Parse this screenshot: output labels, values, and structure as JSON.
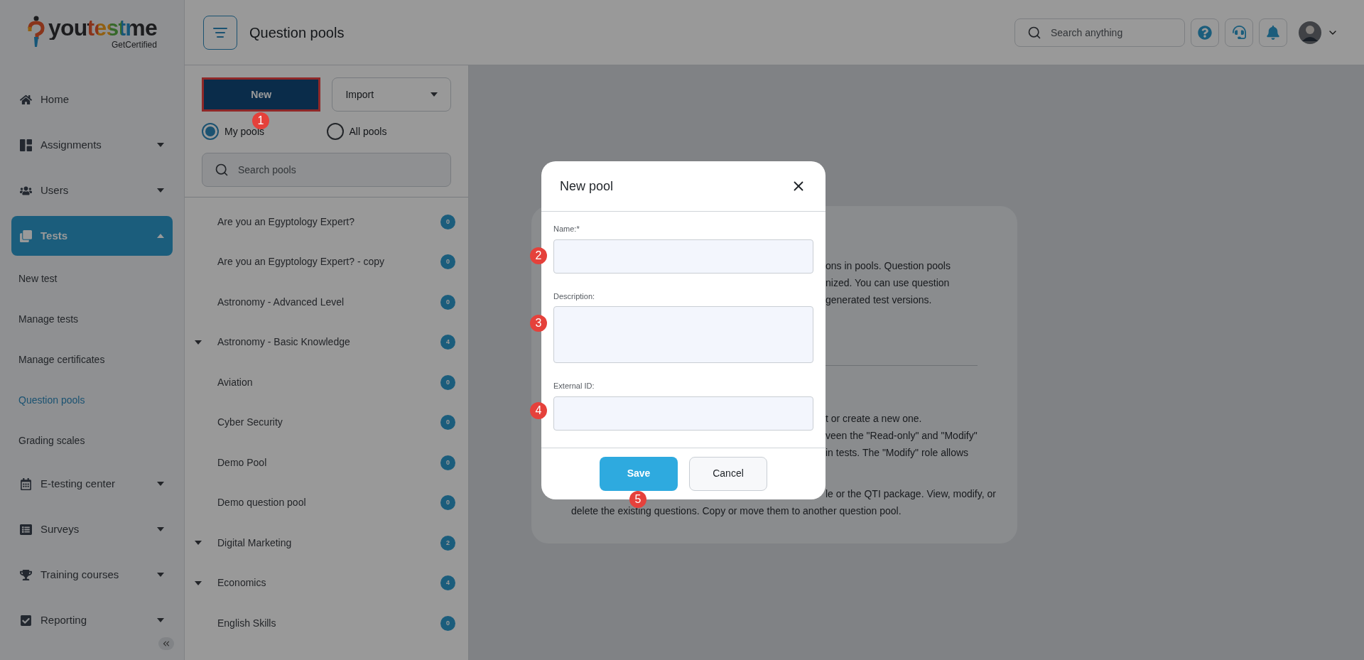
{
  "sidebar": {
    "logo": {
      "wordmark": "youtestme",
      "tagline": "GetCertified"
    },
    "items": [
      {
        "label": "Home",
        "kind": "link",
        "selected": false
      },
      {
        "label": "Assignments",
        "kind": "group",
        "expanded": false,
        "selected": false
      },
      {
        "label": "Users",
        "kind": "group",
        "expanded": false,
        "selected": false
      },
      {
        "label": "Tests",
        "kind": "group",
        "expanded": true,
        "selected": true,
        "children": [
          {
            "label": "New test",
            "selected": false
          },
          {
            "label": "Manage tests",
            "selected": false
          },
          {
            "label": "Manage certificates",
            "selected": false
          },
          {
            "label": "Question pools",
            "selected": true
          },
          {
            "label": "Grading scales",
            "selected": false
          }
        ]
      },
      {
        "label": "E-testing center",
        "kind": "group",
        "expanded": false,
        "selected": false
      },
      {
        "label": "Surveys",
        "kind": "group",
        "expanded": false,
        "selected": false
      },
      {
        "label": "Training courses",
        "kind": "group",
        "expanded": false,
        "selected": false
      },
      {
        "label": "Reporting",
        "kind": "group",
        "expanded": false,
        "selected": false
      }
    ]
  },
  "header": {
    "title": "Question pools",
    "search": {
      "placeholder": "Search anything"
    }
  },
  "pools_panel": {
    "new_button": {
      "label": "New",
      "highlighted": true
    },
    "import_button": "Import",
    "filters": [
      {
        "label": "My pools",
        "selected": true
      },
      {
        "label": "All pools",
        "selected": false
      }
    ],
    "search": {
      "placeholder": "Search pools"
    },
    "pools": [
      {
        "name": "Are you an Egyptology Expert?",
        "count": "0",
        "expandable": false
      },
      {
        "name": "Are you an Egyptology Expert? - copy",
        "count": "0",
        "expandable": false
      },
      {
        "name": "Astronomy - Advanced Level",
        "count": "0",
        "expandable": false
      },
      {
        "name": "Astronomy - Basic Knowledge",
        "count": "4",
        "expandable": true
      },
      {
        "name": "Aviation",
        "count": "0",
        "expandable": false
      },
      {
        "name": "Cyber Security",
        "count": "0",
        "expandable": false
      },
      {
        "name": "Demo Pool",
        "count": "0",
        "expandable": false
      },
      {
        "name": "Demo question pool",
        "count": "0",
        "expandable": false
      },
      {
        "name": "Digital Marketing",
        "count": "2",
        "expandable": true
      },
      {
        "name": "Economics",
        "count": "4",
        "expandable": true
      },
      {
        "name": "English Skills",
        "count": "0",
        "expandable": false
      }
    ]
  },
  "info_card": {
    "lines": [
      {
        "text": "ons in pools. Question pools",
        "kind": "cut"
      },
      {
        "text": "nized. You can use question",
        "kind": "cut"
      },
      {
        "text": "generated test versions.",
        "kind": "cut"
      },
      {
        "kind": "divider"
      },
      {
        "text": "t or create a new one.",
        "kind": "cut"
      },
      {
        "text": "veen the \"Read-only\" and \"Modify\"",
        "kind": "cut"
      },
      {
        "text": "in tests. The \"Modify\" role allows",
        "kind": "cut"
      },
      {
        "kind": "gap"
      },
      {
        "text": "le or the QTI package. View, modify, or",
        "kind": "cut"
      },
      {
        "text": "delete the existing questions. Copy or move them to another question pool.",
        "kind": "full"
      }
    ]
  },
  "dialog": {
    "title": "New pool",
    "fields": [
      {
        "label": "Name:*",
        "kind": "input"
      },
      {
        "label": "Description:",
        "kind": "textarea"
      },
      {
        "label": "External ID:",
        "kind": "input"
      }
    ],
    "buttons": [
      {
        "label": "Save",
        "kind": "primary"
      },
      {
        "label": "Cancel",
        "kind": "secondary"
      }
    ]
  },
  "callouts": [
    "1",
    "2",
    "3",
    "4",
    "5"
  ]
}
